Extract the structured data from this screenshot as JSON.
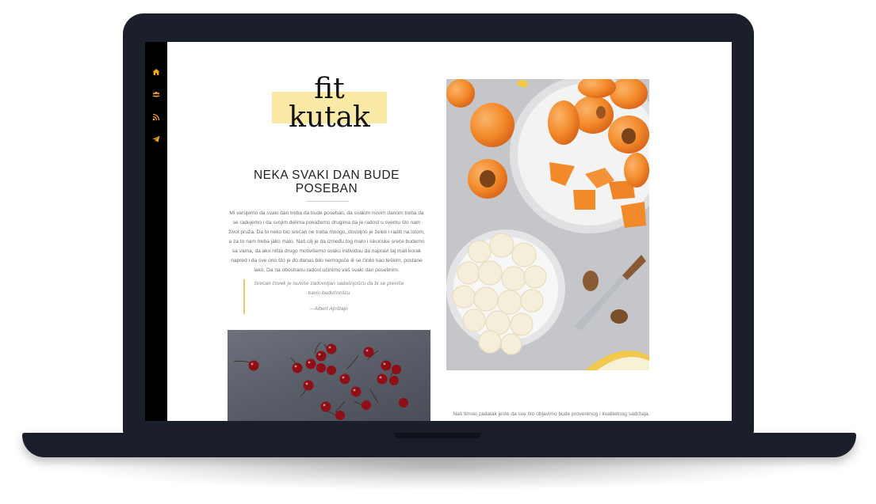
{
  "sidebar": {
    "icons": [
      "home-icon",
      "users-icon",
      "rss-icon",
      "paper-plane-icon"
    ],
    "accent_color": "#f5a623"
  },
  "logo": {
    "line1": "fit",
    "line2": "kutak",
    "highlight_color": "#fbe9a6"
  },
  "article": {
    "heading": "NEKA SVAKI DAN BUDE POSEBAN",
    "body": "Mi verujemo da svaki dan treba da bude poseban, da svakim novim danom treba da se radujemo i da svojim delima pokažemo drugima da je radost u svemu što nam život pruža. Da bi neko bio srećan ne treba mnogo, dovoljno je želeti i raditi na istom, a za to nam treba jako malo. Naš cilj je da između tog malo i iskonske sreće budemo sa vama, da ako ništa drugo motivišemo svaku individuu da napravi taj mali korak napred i da sve ono što je do danas bilo nemoguće ili se činilo kao teškim, postane lako. Da na obostranu radost učinimo vaš svaki dan posebnim.",
    "quote": "Srećan čovek je isuviše zadovoljan sadašnjošću da bi se previše bavio budućnošću",
    "quote_author": "– Albert Ajnštajn"
  },
  "footer": {
    "text": "Naš timski zadatak jeste da sve što objavimo bude proverenog i kvalitetnog sadržaja."
  },
  "images": {
    "left": "cherries-photo",
    "right": "apricots-and-banana-photo"
  },
  "device": {
    "frame_color": "#1b1f2b"
  }
}
